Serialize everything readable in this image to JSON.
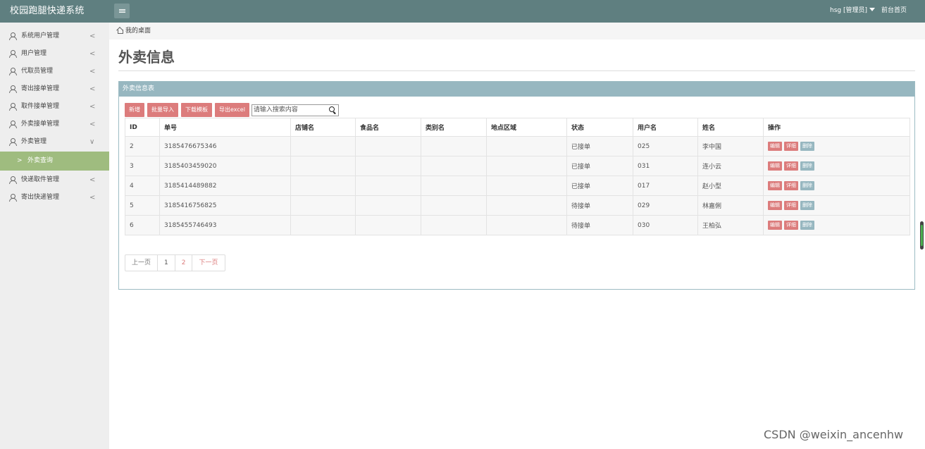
{
  "header": {
    "brand": "校园跑腿快递系统",
    "user": "hsg [管理员]",
    "front_link": "前台首页"
  },
  "sidebar": {
    "items": [
      {
        "label": "系统用户管理"
      },
      {
        "label": "用户管理"
      },
      {
        "label": "代取员管理"
      },
      {
        "label": "寄出接单管理"
      },
      {
        "label": "取件接单管理"
      },
      {
        "label": "外卖接单管理"
      },
      {
        "label": "外卖管理"
      }
    ],
    "sub_item": {
      "label": "外卖查询"
    },
    "items_after": [
      {
        "label": "快递取件管理"
      },
      {
        "label": "寄出快递管理"
      }
    ],
    "chevron_left": "<",
    "chevron_down": "∨",
    "sub_arrow": ">"
  },
  "breadcrumb": {
    "home": "我的桌面"
  },
  "page": {
    "title": "外卖信息"
  },
  "panel": {
    "title": "外卖信息表"
  },
  "toolbar": {
    "add": "新增",
    "import": "批量导入",
    "template": "下载模板",
    "export": "导出excel",
    "search_placeholder": "请输入搜索内容"
  },
  "table": {
    "headers": [
      "ID",
      "单号",
      "店铺名",
      "食品名",
      "类别名",
      "地点区域",
      "状态",
      "用户名",
      "姓名",
      "操作"
    ],
    "rows": [
      {
        "id": "2",
        "order": "3185476675346",
        "shop": "",
        "food": "",
        "category": "",
        "area": "",
        "status": "已接单",
        "username": "025",
        "name": "李中国"
      },
      {
        "id": "3",
        "order": "3185403459020",
        "shop": "",
        "food": "",
        "category": "",
        "area": "",
        "status": "已接单",
        "username": "031",
        "name": "连小云"
      },
      {
        "id": "4",
        "order": "3185414489882",
        "shop": "",
        "food": "",
        "category": "",
        "area": "",
        "status": "已接单",
        "username": "017",
        "name": "赵小型"
      },
      {
        "id": "5",
        "order": "3185416756825",
        "shop": "",
        "food": "",
        "category": "",
        "area": "",
        "status": "待接单",
        "username": "029",
        "name": "林嘉俐"
      },
      {
        "id": "6",
        "order": "3185455746493",
        "shop": "",
        "food": "",
        "category": "",
        "area": "",
        "status": "待接单",
        "username": "030",
        "name": "王柏弘"
      }
    ],
    "ops": {
      "edit": "编辑",
      "detail": "详细",
      "delete": "删除"
    }
  },
  "pager": {
    "prev": "上一页",
    "p1": "1",
    "p2": "2",
    "next": "下一页"
  },
  "watermark": "CSDN @weixin_ancenhw"
}
